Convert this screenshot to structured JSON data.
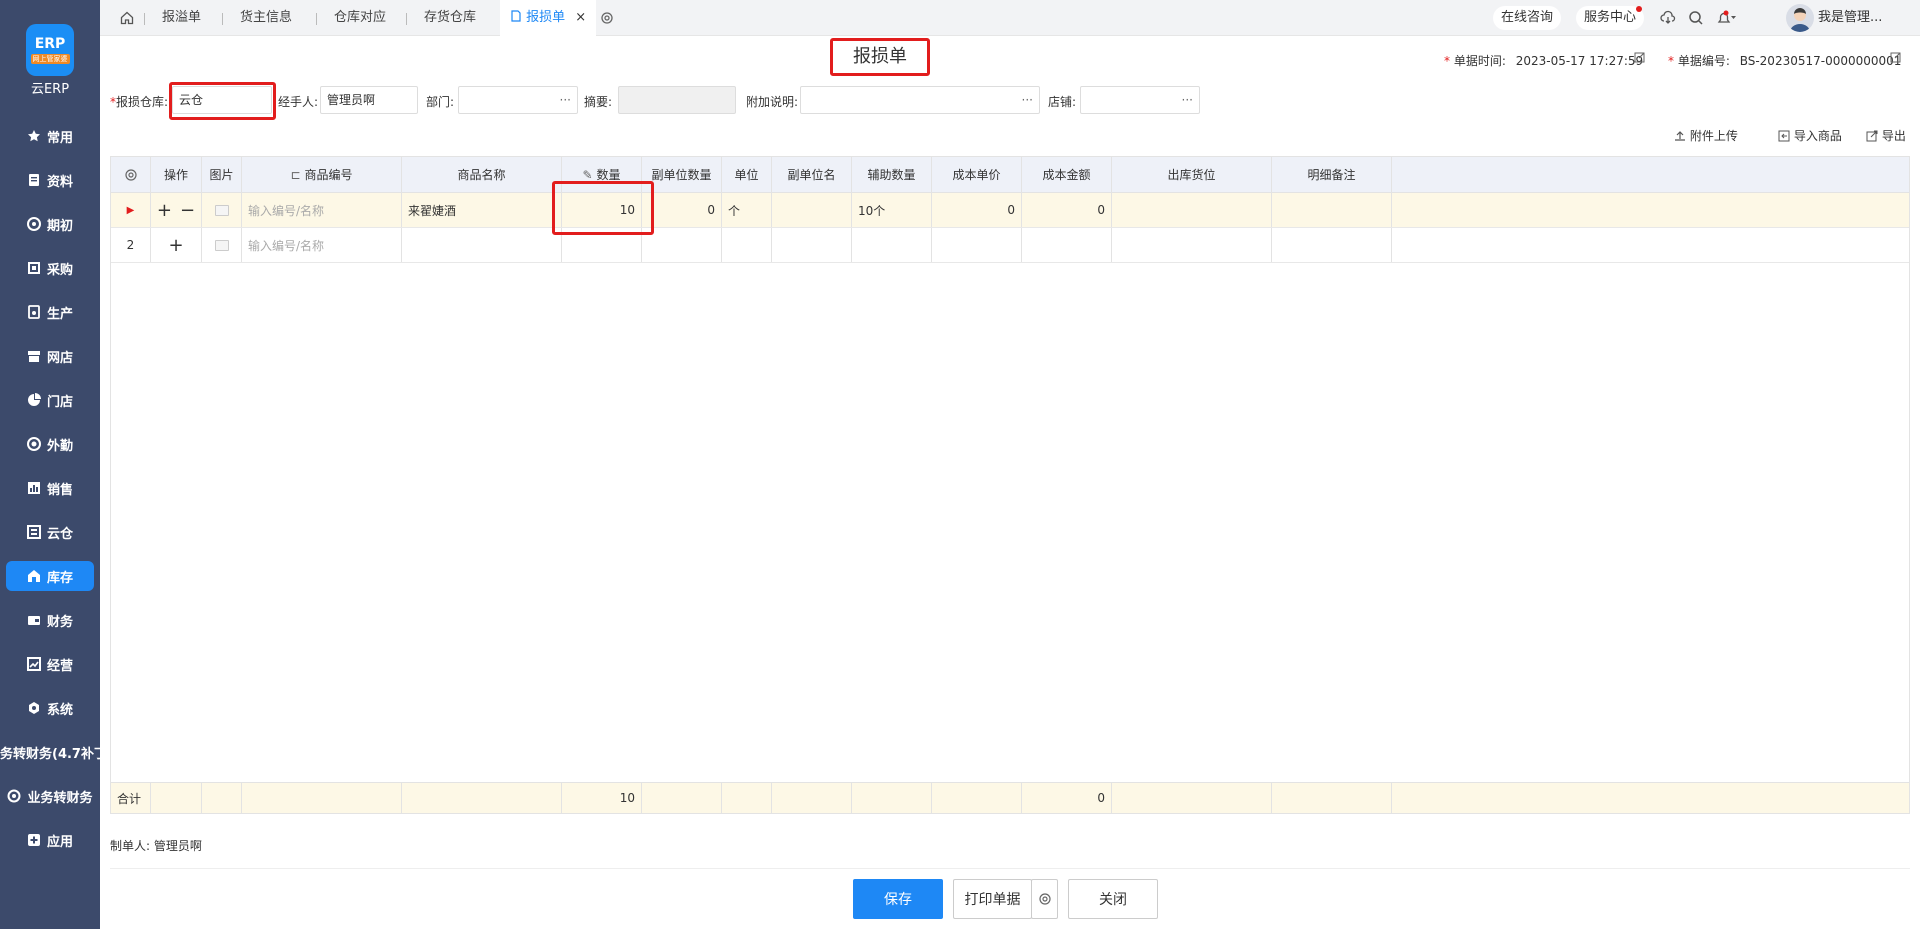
{
  "sidebar": {
    "logo_sub": "网上管家婆",
    "logo_text": "云ERP",
    "items": [
      {
        "label": "常用",
        "icon": "star-icon"
      },
      {
        "label": "资料",
        "icon": "document-icon"
      },
      {
        "label": "期初",
        "icon": "target-icon"
      },
      {
        "label": "采购",
        "icon": "cart-icon"
      },
      {
        "label": "生产",
        "icon": "factory-icon"
      },
      {
        "label": "网店",
        "icon": "store-icon"
      },
      {
        "label": "门店",
        "icon": "pie-icon"
      },
      {
        "label": "外勤",
        "icon": "location-icon"
      },
      {
        "label": "销售",
        "icon": "bar-chart-icon"
      },
      {
        "label": "云仓",
        "icon": "warehouse-icon"
      },
      {
        "label": "库存",
        "icon": "home-icon",
        "active": true
      },
      {
        "label": "财务",
        "icon": "wallet-icon"
      },
      {
        "label": "经营",
        "icon": "trend-icon"
      },
      {
        "label": "系统",
        "icon": "gear-icon"
      },
      {
        "label": "务转财务(4.7补丁",
        "icon": ""
      },
      {
        "label": "业务转财务",
        "icon": "refresh-icon"
      },
      {
        "label": "应用",
        "icon": "plus-square-icon"
      }
    ]
  },
  "tabs": {
    "items": [
      "报溢单",
      "货主信息",
      "仓库对应",
      "存货仓库"
    ],
    "active": "报损单"
  },
  "topbar": {
    "consult": "在线咨询",
    "service": "服务中心",
    "user": "我是管理..."
  },
  "form": {
    "title": "报损单",
    "date_label": "单据时间:",
    "date_value": "2023-05-17 17:27:59",
    "number_label": "单据编号:",
    "number_value": "BS-20230517-0000000001",
    "warehouse_label": "报损仓库:",
    "warehouse_value": "云仓",
    "handler_label": "经手人:",
    "handler_value": "管理员啊",
    "dept_label": "部门:",
    "dept_value": "",
    "summary_label": "摘要:",
    "summary_value": "",
    "note_label": "附加说明:",
    "note_value": "",
    "shop_label": "店铺:",
    "shop_value": ""
  },
  "actions": {
    "upload": "附件上传",
    "import": "导入商品",
    "export": "导出"
  },
  "table": {
    "headers": [
      "操作",
      "图片",
      "商品编号",
      "商品名称",
      "数量",
      "副单位数量",
      "单位",
      "副单位名",
      "辅助数量",
      "成本单价",
      "成本金额",
      "出库货位",
      "明细备注"
    ],
    "code_placeholder": "输入编号/名称",
    "row1": {
      "name": "来翟婕酒",
      "qty": "10",
      "sub_qty": "0",
      "unit": "个",
      "aux_qty": "10个",
      "cost_price": "0",
      "cost_amount": "0"
    },
    "row2": {
      "index": "2"
    },
    "total": {
      "label": "合计",
      "qty": "10",
      "cost_amount": "0"
    }
  },
  "footer": {
    "maker_label": "制单人:",
    "maker_value": "管理员啊",
    "save": "保存",
    "print": "打印单据",
    "close": "关闭"
  },
  "colors": {
    "accent": "#1e88f5",
    "sidebar": "#3c4a6b",
    "highlight": "#e21d1d"
  }
}
